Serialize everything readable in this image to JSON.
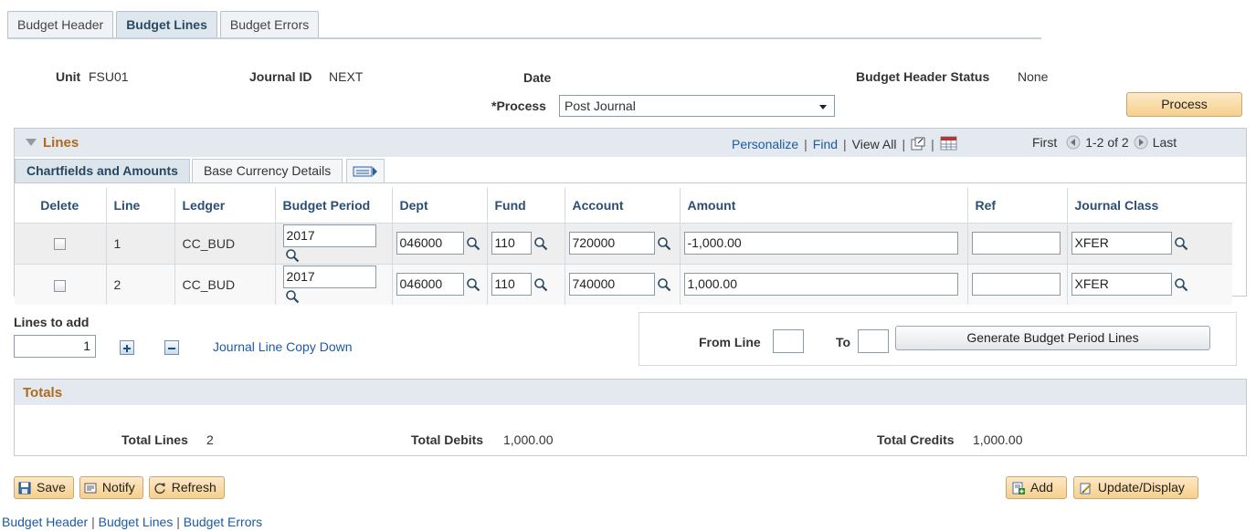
{
  "tabs": [
    {
      "label": "Budget Header"
    },
    {
      "label": "Budget Lines"
    },
    {
      "label": "Budget Errors"
    }
  ],
  "header": {
    "unit_label": "Unit",
    "unit_value": "FSU01",
    "journal_label": "Journal ID",
    "journal_value": "NEXT",
    "date_label": "Date",
    "status_label": "Budget Header Status",
    "status_value": "None",
    "process_label": "*Process",
    "process_value": "Post Journal",
    "process_button": "Process"
  },
  "lines": {
    "title": "Lines",
    "personalize": "Personalize",
    "find": "Find",
    "view_all": "View All",
    "first": "First",
    "range": "1-2 of 2",
    "last": "Last",
    "tabs": [
      {
        "label": "Chartfields and Amounts"
      },
      {
        "label": "Base Currency Details"
      }
    ],
    "columns": [
      "Delete",
      "Line",
      "Ledger",
      "Budget Period",
      "Dept",
      "Fund",
      "Account",
      "Amount",
      "Ref",
      "Journal Class"
    ],
    "rows": [
      {
        "line": "1",
        "ledger": "CC_BUD",
        "period": "2017",
        "dept": "046000",
        "fund": "110",
        "account": "720000",
        "amount": "-1,000.00",
        "ref": "",
        "jclass": "XFER"
      },
      {
        "line": "2",
        "ledger": "CC_BUD",
        "period": "2017",
        "dept": "046000",
        "fund": "110",
        "account": "740000",
        "amount": "1,000.00",
        "ref": "",
        "jclass": "XFER"
      }
    ]
  },
  "add_lines": {
    "label": "Lines to add",
    "value": "1",
    "copy_down": "Journal Line Copy Down"
  },
  "generate": {
    "from_label": "From Line",
    "to_label": "To",
    "button": "Generate Budget Period Lines"
  },
  "totals": {
    "title": "Totals",
    "lines_label": "Total Lines",
    "lines_value": "2",
    "debits_label": "Total Debits",
    "debits_value": "1,000.00",
    "credits_label": "Total Credits",
    "credits_value": "1,000.00"
  },
  "toolbar": {
    "save": "Save",
    "notify": "Notify",
    "refresh": "Refresh",
    "add": "Add",
    "update": "Update/Display"
  },
  "footer_links": [
    "Budget Header",
    "Budget Lines",
    "Budget Errors"
  ]
}
